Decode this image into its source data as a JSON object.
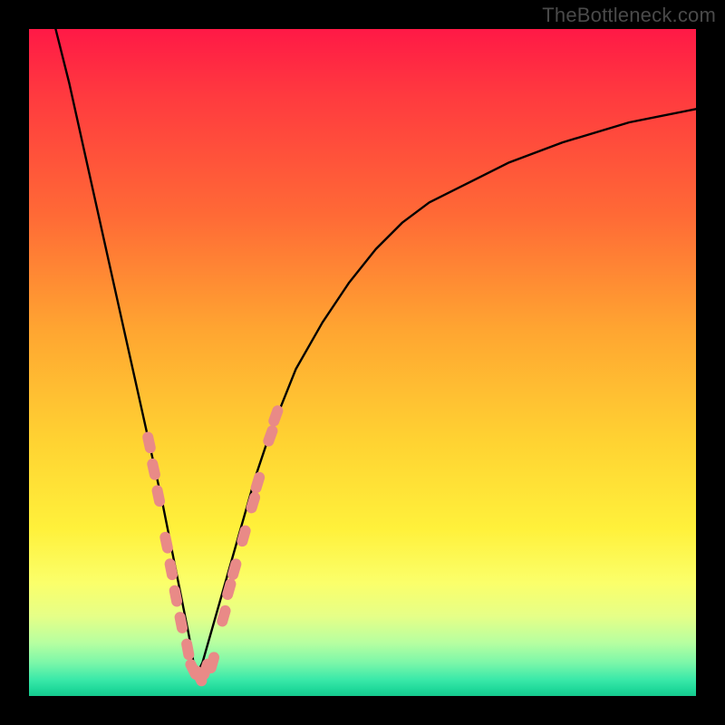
{
  "watermark": "TheBottleneck.com",
  "colors": {
    "curve_stroke": "#000000",
    "marker_fill": "#e98a87",
    "gradient_top": "#ff1946",
    "gradient_bottom": "#16c98e",
    "frame": "#000000"
  },
  "chart_data": {
    "type": "line",
    "title": "",
    "xlabel": "",
    "ylabel": "",
    "xlim": [
      0,
      100
    ],
    "ylim": [
      0,
      100
    ],
    "grid": false,
    "series": [
      {
        "name": "bottleneck-curve",
        "description": "V-shaped bottleneck curve; steep descent from top-left to a minimum near x≈25, then rising concave toward top-right.",
        "x": [
          4,
          6,
          8,
          10,
          12,
          14,
          16,
          18,
          20,
          22,
          24,
          25,
          26,
          28,
          30,
          32,
          34,
          36,
          38,
          40,
          44,
          48,
          52,
          56,
          60,
          66,
          72,
          80,
          90,
          100
        ],
        "y": [
          100,
          92,
          83,
          74,
          65,
          56,
          47,
          38,
          29,
          19,
          9,
          3,
          5,
          12,
          19,
          26,
          33,
          39,
          44,
          49,
          56,
          62,
          67,
          71,
          74,
          77,
          80,
          83,
          86,
          88
        ]
      }
    ],
    "markers": {
      "description": "Salmon pill-shaped markers clustered near the bottom of the V on both branches.",
      "points": [
        {
          "x": 18.0,
          "y": 38
        },
        {
          "x": 18.7,
          "y": 34
        },
        {
          "x": 19.4,
          "y": 30
        },
        {
          "x": 20.6,
          "y": 23
        },
        {
          "x": 21.3,
          "y": 19
        },
        {
          "x": 22.0,
          "y": 15
        },
        {
          "x": 22.8,
          "y": 11
        },
        {
          "x": 23.8,
          "y": 7
        },
        {
          "x": 24.6,
          "y": 4
        },
        {
          "x": 25.5,
          "y": 3
        },
        {
          "x": 26.5,
          "y": 4
        },
        {
          "x": 27.5,
          "y": 5
        },
        {
          "x": 29.2,
          "y": 12
        },
        {
          "x": 30.0,
          "y": 16
        },
        {
          "x": 30.8,
          "y": 19
        },
        {
          "x": 32.2,
          "y": 24
        },
        {
          "x": 33.6,
          "y": 29
        },
        {
          "x": 34.3,
          "y": 32
        },
        {
          "x": 36.2,
          "y": 39
        },
        {
          "x": 37.0,
          "y": 42
        }
      ]
    }
  }
}
